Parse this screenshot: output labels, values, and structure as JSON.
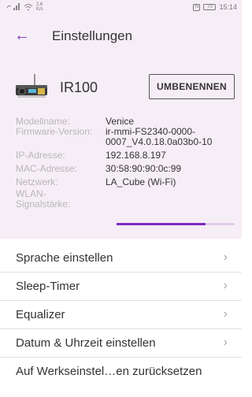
{
  "status_bar": {
    "left_icons": [
      "phone-signal-icon",
      "wifi-icon"
    ],
    "speed_value": "2,6",
    "speed_unit": "K/s",
    "nfc_label": "N",
    "battery_level": "70",
    "time": "15:14"
  },
  "app_bar": {
    "back_glyph": "←",
    "title": "Einstellungen"
  },
  "device": {
    "icon": "radio-device-icon",
    "name": "IR100",
    "rename_label": "UMBENENNEN"
  },
  "info": {
    "model": {
      "label": "Modellname:",
      "value": "Venice"
    },
    "firmware": {
      "label": "Firmware-Version:",
      "value": "ir-mmi-FS2340-0000-0007_V4.0.18.0a03b0-10"
    },
    "ip": {
      "label": "IP-Adresse:",
      "value": "192.168.8.197"
    },
    "mac": {
      "label": "MAC-Adresse:",
      "value": "30:58:90:90:0c:99"
    },
    "network": {
      "label": "Netzwerk:",
      "value": "LA_Cube (Wi-Fi)"
    },
    "wlan": {
      "label": "WLAN-Signalstärke:",
      "signal_fraction": 0.75
    }
  },
  "menu": {
    "items": [
      {
        "label": "Sprache einstellen",
        "chevron": "›"
      },
      {
        "label": "Sleep-Timer",
        "chevron": "›"
      },
      {
        "label": "Equalizer",
        "chevron": "›"
      },
      {
        "label": "Datum & Uhrzeit einstellen",
        "chevron": "›"
      },
      {
        "label": "Auf Werkseinstel…en zurücksetzen",
        "chevron": ""
      }
    ]
  },
  "colors": {
    "accent": "#7b2cbf",
    "header_bg": "#f6eef6",
    "signal_track": "#e3cde9"
  }
}
